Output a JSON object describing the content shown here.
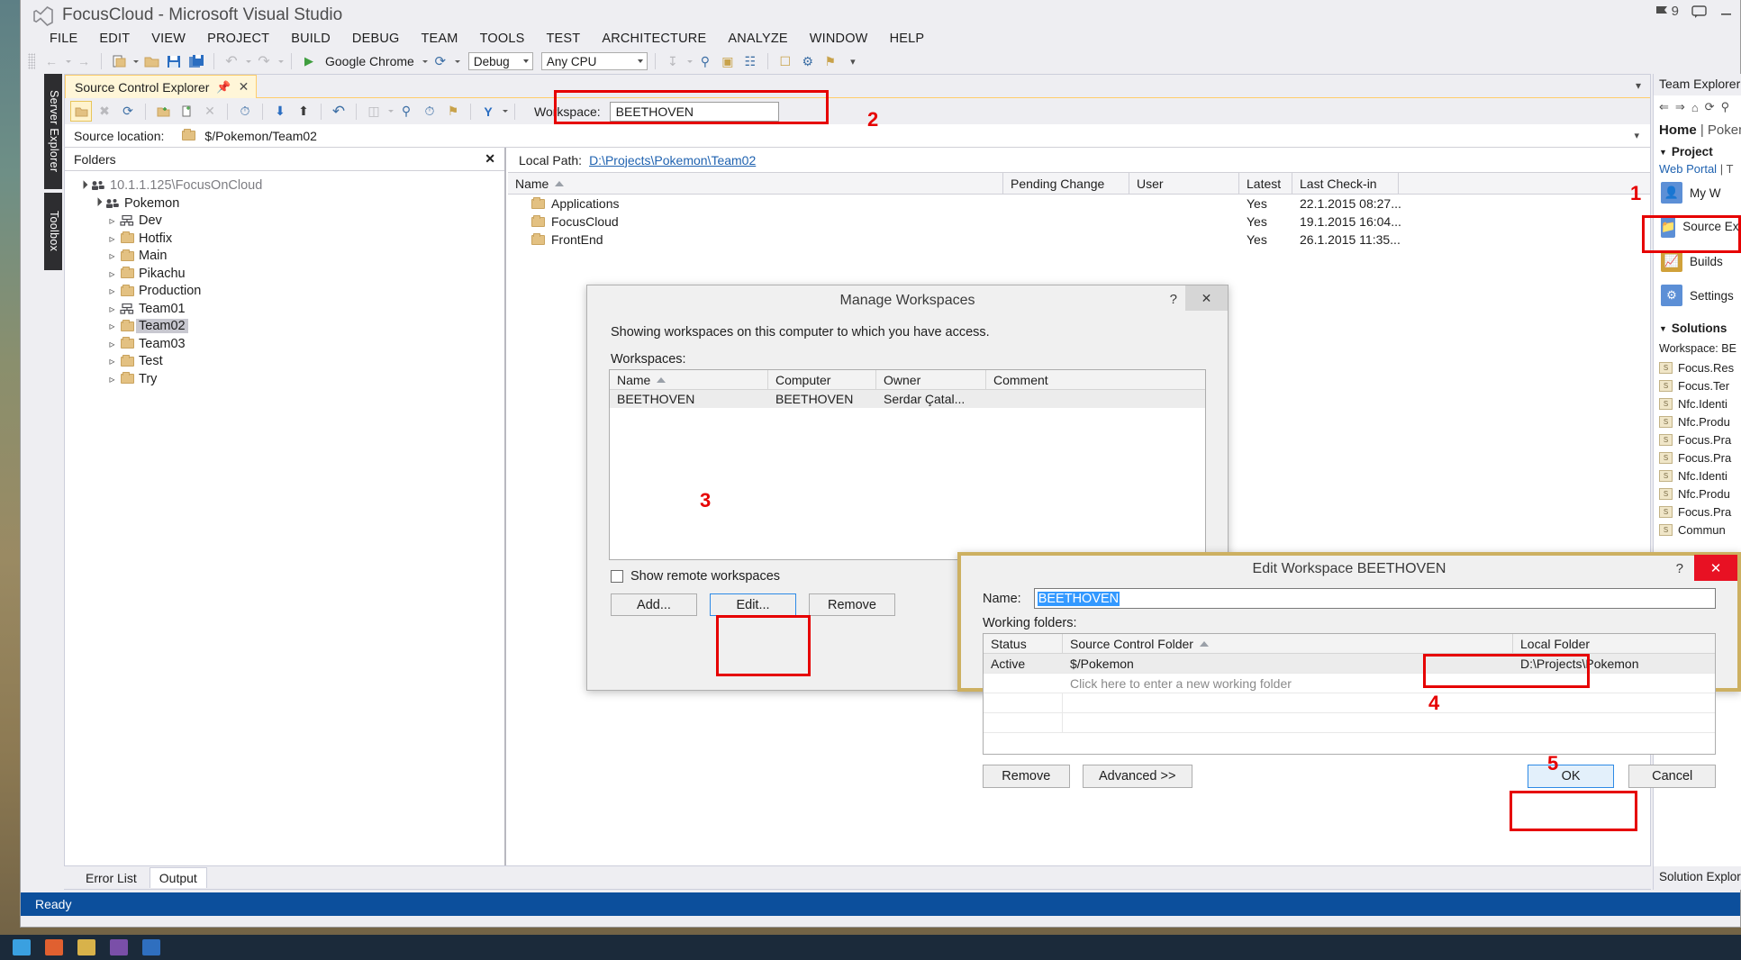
{
  "window": {
    "title": "FocusCloud - Microsoft Visual Studio",
    "logo_icon": "visual-studio-logo-icon"
  },
  "title_right": {
    "notifications_icon": "flag-icon",
    "notifications_count": "9",
    "feedback_icon": "comment-icon",
    "minimize_icon": "minimize-icon"
  },
  "menu": {
    "items": [
      "FILE",
      "EDIT",
      "VIEW",
      "PROJECT",
      "BUILD",
      "DEBUG",
      "TEAM",
      "TOOLS",
      "TEST",
      "ARCHITECTURE",
      "ANALYZE",
      "WINDOW",
      "HELP"
    ]
  },
  "toolbar": {
    "back_icon": "navigate-back-icon",
    "forward_icon": "navigate-forward-icon",
    "new_project_icon": "new-project-icon",
    "open_file_icon": "open-file-icon",
    "save_icon": "save-icon",
    "save_all_icon": "save-all-icon",
    "undo_icon": "undo-icon",
    "redo_icon": "redo-icon",
    "start_icon": "start-debug-play-icon",
    "start_label": "Google Chrome",
    "refresh_icon": "refresh-browser-icon",
    "configuration": "Debug",
    "platform": "Any CPU",
    "step_icon": "step-into-icon",
    "find_icon": "find-icon"
  },
  "vertical_tabs": {
    "server_explorer": "Server Explorer",
    "toolbox": "Toolbox"
  },
  "source_control_explorer": {
    "tab_label": "Source Control Explorer",
    "pin_icon": "pin-icon",
    "close_icon": "close-icon",
    "chevron_icon": "chevron-down-icon",
    "toolbar_icons": [
      "folder-view-icon",
      "branch-disabled-icon",
      "refresh-icon",
      "add-folder-icon",
      "add-file-icon",
      "delete-icon",
      "get-latest-icon",
      "check-out-icon",
      "check-in-icon",
      "undo-pending-icon",
      "compare-icon",
      "find-in-sc-icon",
      "history-icon",
      "label-icon",
      "branch-merge-icon"
    ],
    "workspace_label": "Workspace:",
    "workspace_value": "BEETHOVEN",
    "source_location_label": "Source location:",
    "source_location_value": "$/Pokemon/Team02",
    "folders_header": "Folders",
    "folders_close_icon": "close-icon",
    "tree": [
      {
        "label": "10.1.1.125\\FocusOnCloud",
        "icon": "team-project-collection-icon",
        "indent": 0,
        "state": "open",
        "muted": true,
        "selected": false
      },
      {
        "label": "Pokemon",
        "icon": "team-project-icon",
        "indent": 1,
        "state": "open",
        "muted": false,
        "selected": false
      },
      {
        "label": "Dev",
        "icon": "branch-icon",
        "indent": 2,
        "state": "closed",
        "muted": false,
        "selected": false
      },
      {
        "label": "Hotfix",
        "icon": "folder-icon",
        "indent": 2,
        "state": "closed",
        "muted": false,
        "selected": false
      },
      {
        "label": "Main",
        "icon": "folder-icon",
        "indent": 2,
        "state": "closed",
        "muted": false,
        "selected": false
      },
      {
        "label": "Pikachu",
        "icon": "folder-icon",
        "indent": 2,
        "state": "closed",
        "muted": false,
        "selected": false
      },
      {
        "label": "Production",
        "icon": "folder-icon",
        "indent": 2,
        "state": "closed",
        "muted": false,
        "selected": false
      },
      {
        "label": "Team01",
        "icon": "branch-icon",
        "indent": 2,
        "state": "closed",
        "muted": false,
        "selected": false
      },
      {
        "label": "Team02",
        "icon": "folder-icon",
        "indent": 2,
        "state": "closed",
        "muted": false,
        "selected": true
      },
      {
        "label": "Team03",
        "icon": "folder-icon",
        "indent": 2,
        "state": "closed",
        "muted": false,
        "selected": false
      },
      {
        "label": "Test",
        "icon": "folder-icon",
        "indent": 2,
        "state": "closed",
        "muted": false,
        "selected": false
      },
      {
        "label": "Try",
        "icon": "folder-icon",
        "indent": 2,
        "state": "closed",
        "muted": false,
        "selected": false
      }
    ],
    "local_path_label": "Local Path:",
    "local_path_value": "D:\\Projects\\Pokemon\\Team02",
    "columns": [
      "Name",
      "Pending Change",
      "User",
      "Latest",
      "Last Check-in"
    ],
    "sort_icon": "sort-ascending-icon",
    "rows": [
      {
        "name": "Applications",
        "icon": "folder-icon",
        "pending_change": "",
        "user": "",
        "latest": "Yes",
        "last_checkin": "22.1.2015 08:27..."
      },
      {
        "name": "FocusCloud",
        "icon": "folder-icon",
        "pending_change": "",
        "user": "",
        "latest": "Yes",
        "last_checkin": "19.1.2015 16:04..."
      },
      {
        "name": "FrontEnd",
        "icon": "folder-icon",
        "pending_change": "",
        "user": "",
        "latest": "Yes",
        "last_checkin": "26.1.2015 11:35..."
      }
    ]
  },
  "team_explorer": {
    "title": "Team Explorer -",
    "toolbar_icons": [
      "back-icon",
      "forward-icon",
      "home-icon",
      "refresh-icon",
      "search-icon"
    ],
    "home_label": "Home",
    "home_project": "| Pokem",
    "project_section": "Project",
    "web_portal_link": "Web Portal",
    "web_portal_sep": "| T",
    "nav": [
      {
        "label": "My W",
        "icon": "my-work-icon"
      },
      {
        "label": "Source Explor",
        "icon": "source-control-explorer-icon"
      },
      {
        "label": "Builds",
        "icon": "builds-icon"
      },
      {
        "label": "Settings",
        "icon": "settings-gear-icon"
      }
    ],
    "solutions_section": "Solutions",
    "workspace_label": "Workspace: BE",
    "solution_items": [
      "Focus.Res",
      "Focus.Ter",
      "Nfc.Identi",
      "Nfc.Produ",
      "Focus.Pra",
      "Focus.Pra",
      "Nfc.Identi",
      "Nfc.Produ",
      "Focus.Pra",
      "Commun"
    ],
    "footer": "Solution Explore"
  },
  "bottom": {
    "tabs": [
      "Error List",
      "Output"
    ],
    "active_tab": "Output",
    "status": "Ready"
  },
  "manage_workspaces_dialog": {
    "title": "Manage Workspaces",
    "help_icon": "help-question-icon",
    "close_icon": "close-icon",
    "description": "Showing workspaces on this computer to which you have access.",
    "workspaces_label": "Workspaces:",
    "columns": [
      "Name",
      "Computer",
      "Owner",
      "Comment"
    ],
    "sort_icon": "sort-ascending-icon",
    "rows": [
      {
        "name": "BEETHOVEN",
        "computer": "BEETHOVEN",
        "owner": "Serdar Çatal...",
        "comment": ""
      }
    ],
    "show_remote_label": "Show remote workspaces",
    "show_remote_checked": false,
    "buttons": {
      "add": "Add...",
      "edit": "Edit...",
      "remove": "Remove"
    }
  },
  "edit_workspace_dialog": {
    "title": "Edit Workspace BEETHOVEN",
    "help_icon": "help-question-icon",
    "close_icon": "close-icon",
    "name_label": "Name:",
    "name_value": "BEETHOVEN",
    "working_folders_label": "Working folders:",
    "columns": [
      "Status",
      "Source Control Folder",
      "Local Folder"
    ],
    "sort_icon": "sort-ascending-icon",
    "rows": [
      {
        "status": "Active",
        "source_control_folder": "$/Pokemon",
        "local_folder": "D:\\Projects\\Pokemon"
      },
      {
        "status": "",
        "source_control_folder": "Click here to enter a new working folder",
        "local_folder": ""
      }
    ],
    "buttons": {
      "remove": "Remove",
      "advanced": "Advanced >>",
      "ok": "OK",
      "cancel": "Cancel"
    }
  },
  "annotations": {
    "accent_color": "#e60000",
    "markers": [
      "1",
      "2",
      "3",
      "4",
      "5"
    ]
  }
}
